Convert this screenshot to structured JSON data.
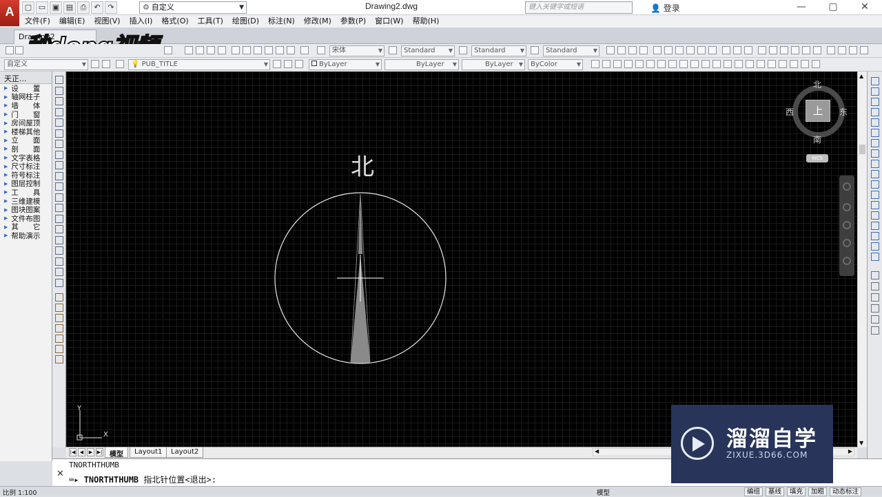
{
  "app": {
    "logo_letter": "A",
    "document_title": "Drawing2.dwg",
    "workspace": "自定义",
    "search_placeholder": "键入关键字或短语",
    "signin": "登录"
  },
  "menu": [
    "文件(F)",
    "编辑(E)",
    "视图(V)",
    "插入(I)",
    "格式(O)",
    "工具(T)",
    "绘图(D)",
    "标注(N)",
    "修改(M)",
    "参数(P)",
    "窗口(W)",
    "帮助(H)"
  ],
  "doc_tab": "Drawing2",
  "video_watermark": "秒dong视频",
  "toolbar": {
    "text_style_font": "宋体",
    "dim_style_1": "Standard",
    "table_style": "Standard",
    "multileader_style": "Standard",
    "workspace_field": "自定义",
    "layer_name": "PUB_TITLE",
    "color": "ByLayer",
    "linetype": "ByLayer",
    "lineweight": "ByLayer",
    "plotstyle": "ByColor"
  },
  "left_panel": {
    "header": "天正...",
    "items": [
      "设　　置",
      "轴网柱子",
      "墙　　体",
      "门　　窗",
      "房间屋顶",
      "楼梯其他",
      "立　　面",
      "剖　　面",
      "文字表格",
      "尺寸标注",
      "符号标注",
      "图层控制",
      "工　　具",
      "三维建模",
      "图块图案",
      "文件布图",
      "其　　它",
      "帮助演示"
    ]
  },
  "viewcube": {
    "top": "上",
    "north": "北",
    "south": "南",
    "east": "东",
    "west": "西",
    "wcs": "WCS"
  },
  "drawing": {
    "north_label": "北"
  },
  "ucs": {
    "x": "X",
    "y": "Y"
  },
  "layout_tabs": [
    "模型",
    "Layout1",
    "Layout2"
  ],
  "command": {
    "history": "TNORTHTHUMB",
    "prompt_cmd": "TNORTHTHUMB",
    "prompt_text": " 指北针位置<退出>:"
  },
  "status": {
    "scale": "比例 1:100",
    "model": "模型",
    "buttons": [
      "编组",
      "基线",
      "填充",
      "加粗",
      "动态标注"
    ]
  },
  "corner_logo": {
    "name": "溜溜自学",
    "url": "ZIXUE.3D66.COM"
  }
}
